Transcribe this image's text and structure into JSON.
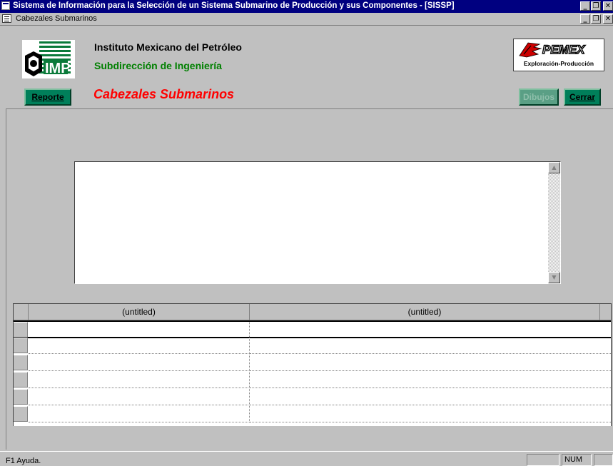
{
  "window": {
    "title": "Sistema de Información para la Selección de un Sistema Submarino de Producción y sus Componentes - [SISSP]",
    "controls": [
      "_",
      "❐",
      "✕"
    ]
  },
  "mdi": {
    "title": "Cabezales Submarinos",
    "controls": [
      "_",
      "❐",
      "✕"
    ]
  },
  "header": {
    "logo_text": "IMP",
    "organization": "Instituto Mexicano del Petróleo",
    "department": "Subdirección de Ingeniería",
    "pemex_name": "PEMEX",
    "pemex_division": "Exploración-Producción"
  },
  "toolbar": {
    "reporte_label": "Reporte",
    "form_title": "Cabezales Submarinos",
    "dibujos_label": "Dibujos",
    "cerrar_label": "Cerrar"
  },
  "memo": {
    "text": ""
  },
  "grid": {
    "columns": [
      "(untitled)",
      "(untitled)"
    ],
    "rows": [
      [
        "",
        ""
      ],
      [
        "",
        ""
      ],
      [
        "",
        ""
      ],
      [
        "",
        ""
      ],
      [
        "",
        ""
      ],
      [
        "",
        ""
      ]
    ]
  },
  "statusbar": {
    "help": "F1  Ayuda.",
    "panel1": "",
    "num": "NUM",
    "panel3": ""
  },
  "colors": {
    "titlebar": "#000080",
    "button_green": "#007f5a",
    "form_title_red": "#ff0000",
    "department_green": "#008000"
  }
}
